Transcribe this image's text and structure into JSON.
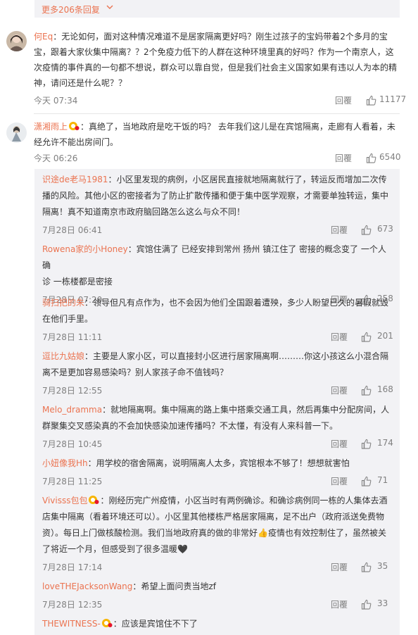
{
  "more": {
    "label": "更多206条回复"
  },
  "comments": [
    {
      "user": "何Eq",
      "sep": "：",
      "text": "无论如何，面对这种情况难道不是居家隔离更好吗？刚生过孩子的宝妈带着2个多月的宝宝，跟着大家伙集中隔离？？2个免疫力低下的人群在这种环境里真的好吗？作为一个南京人，这次疫情的事件真的一句都不想说，群众可以靠自觉，但是我们社会主义国家如果有违以人为本的精神，请问还是什么呢？？",
      "lines": [
        "无论如何，面对这种情况难道不是居家隔离更好吗？刚生过孩子的宝妈带着2个多月的宝",
        "宝，跟着大家伙集中隔离？？2个免疫力低下的人群在这种环境里真的好吗？作为一个南京人，这",
        "次疫情的事件真的一句都不想说，群众可以靠自觉，但是我们社会主义国家如果有违以人为本的精",
        "神，请问还是什么呢？？"
      ],
      "time": "今天 07:34",
      "reply": "回覆",
      "likes": "11177"
    },
    {
      "user": "潇湘雨上",
      "sep": "：",
      "text": "真绝了，当地政府是吃干饭的吗？ 去年我们这儿是在宾馆隔离，走廊有人看着，未经允许不能出房间门。",
      "lines": [
        "真绝了，当地政府是吃干饭的吗？ 去年我们这儿是在宾馆隔离，走廊有人看着，未",
        "经允许不能出房间门。"
      ],
      "time": "今天 06:26",
      "reply": "回覆",
      "likes": "6540"
    }
  ],
  "replies": [
    {
      "user": "识途de老马1981",
      "sep": "：",
      "lines": [
        "小区里发现的病例，小区居民直接就地隔离就行了，转运反而增加二次传",
        "播的风险。其他小区的密接者为了防止扩散传播和便于集中医学观察，才需要单独转运，集中",
        "隔离！真不知道南京市政府脑回路怎么这么与众不同！"
      ],
      "time": "7月28日 06:41",
      "reply": "回覆",
      "likes": "673"
    },
    {
      "user": "Rowena家的小Honey",
      "sep": "：",
      "lines": [
        "宾馆住满了 已经安排到常州 扬州 镇江住了 密接的概念变了 一个人确",
        "诊 一栋楼都是密接"
      ],
      "time": "7月28日 07:20",
      "reply": "回覆",
      "likes": "258"
    },
    {
      "user": "骑扫把的朱",
      "sep": "：",
      "lines": [
        "领导但凡有点作为，也不会因为他们全国跟着遭殃，多少人盼望已久的暑假就毁",
        "在他们手里。"
      ],
      "time": "7月28日 11:11",
      "reply": "回覆",
      "likes": "201"
    },
    {
      "user": "逗比九姑娘",
      "sep": "：",
      "lines": [
        "主要是人家小区，可以直接封小区进行居家隔离啊………你这小孩这么小混合隔",
        "离不是更加容易感染吗？别人家孩子命不值钱吗？"
      ],
      "time": "7月28日 12:55",
      "reply": "回覆",
      "likes": "168"
    },
    {
      "user": "Melo_dramma",
      "sep": "：",
      "lines": [
        "就地隔离啊。集中隔离的路上集中搭乘交通工具，然后再集中分配房间，人",
        "群聚集交叉感染真的不会加快感染加速传播吗？不太懂，有没有人来科普一下。"
      ],
      "time": "7月28日 10:45",
      "reply": "回覆",
      "likes": "174"
    },
    {
      "user": "小妞像我Hh",
      "sep": "：",
      "lines": [
        "用学校的宿舍隔离，说明隔离人太多，宾馆根本不够了！想想就害怕"
      ],
      "time": "7月28日 11:25",
      "reply": "回覆",
      "likes": "71"
    },
    {
      "user": "Vivisss包包",
      "sep": "：",
      "lines": [
        "刚经历完广州疫情，小区当时有两例确诊。和确诊病例同一栋的人集体去酒",
        "店集中隔离（看着环境还可以）。小区里其他楼栋严格居家隔离，足不出户（政府派送免费物",
        "资）。每日上门做核酸检测。我们当地政府真的做的非常好👍疫情也有效控制住了，虽然被关",
        "了将近一个月，但感受到了很多温暖🖤"
      ],
      "time": "7月28日 17:14",
      "reply": "回覆",
      "likes": "35"
    },
    {
      "user": "loveTHEJacksonWang",
      "sep": "：",
      "lines": [
        "希望上面问责当地zf"
      ],
      "time": "7月28日 12:35",
      "reply": "回覆",
      "likes": "33"
    },
    {
      "user": "THEWITNESS-",
      "sep": "：",
      "lines": [
        "应该是宾馆住不下了"
      ]
    }
  ],
  "colors": {
    "username": "#eb7350",
    "meta": "#808080",
    "panel": "#f2f2f5"
  }
}
